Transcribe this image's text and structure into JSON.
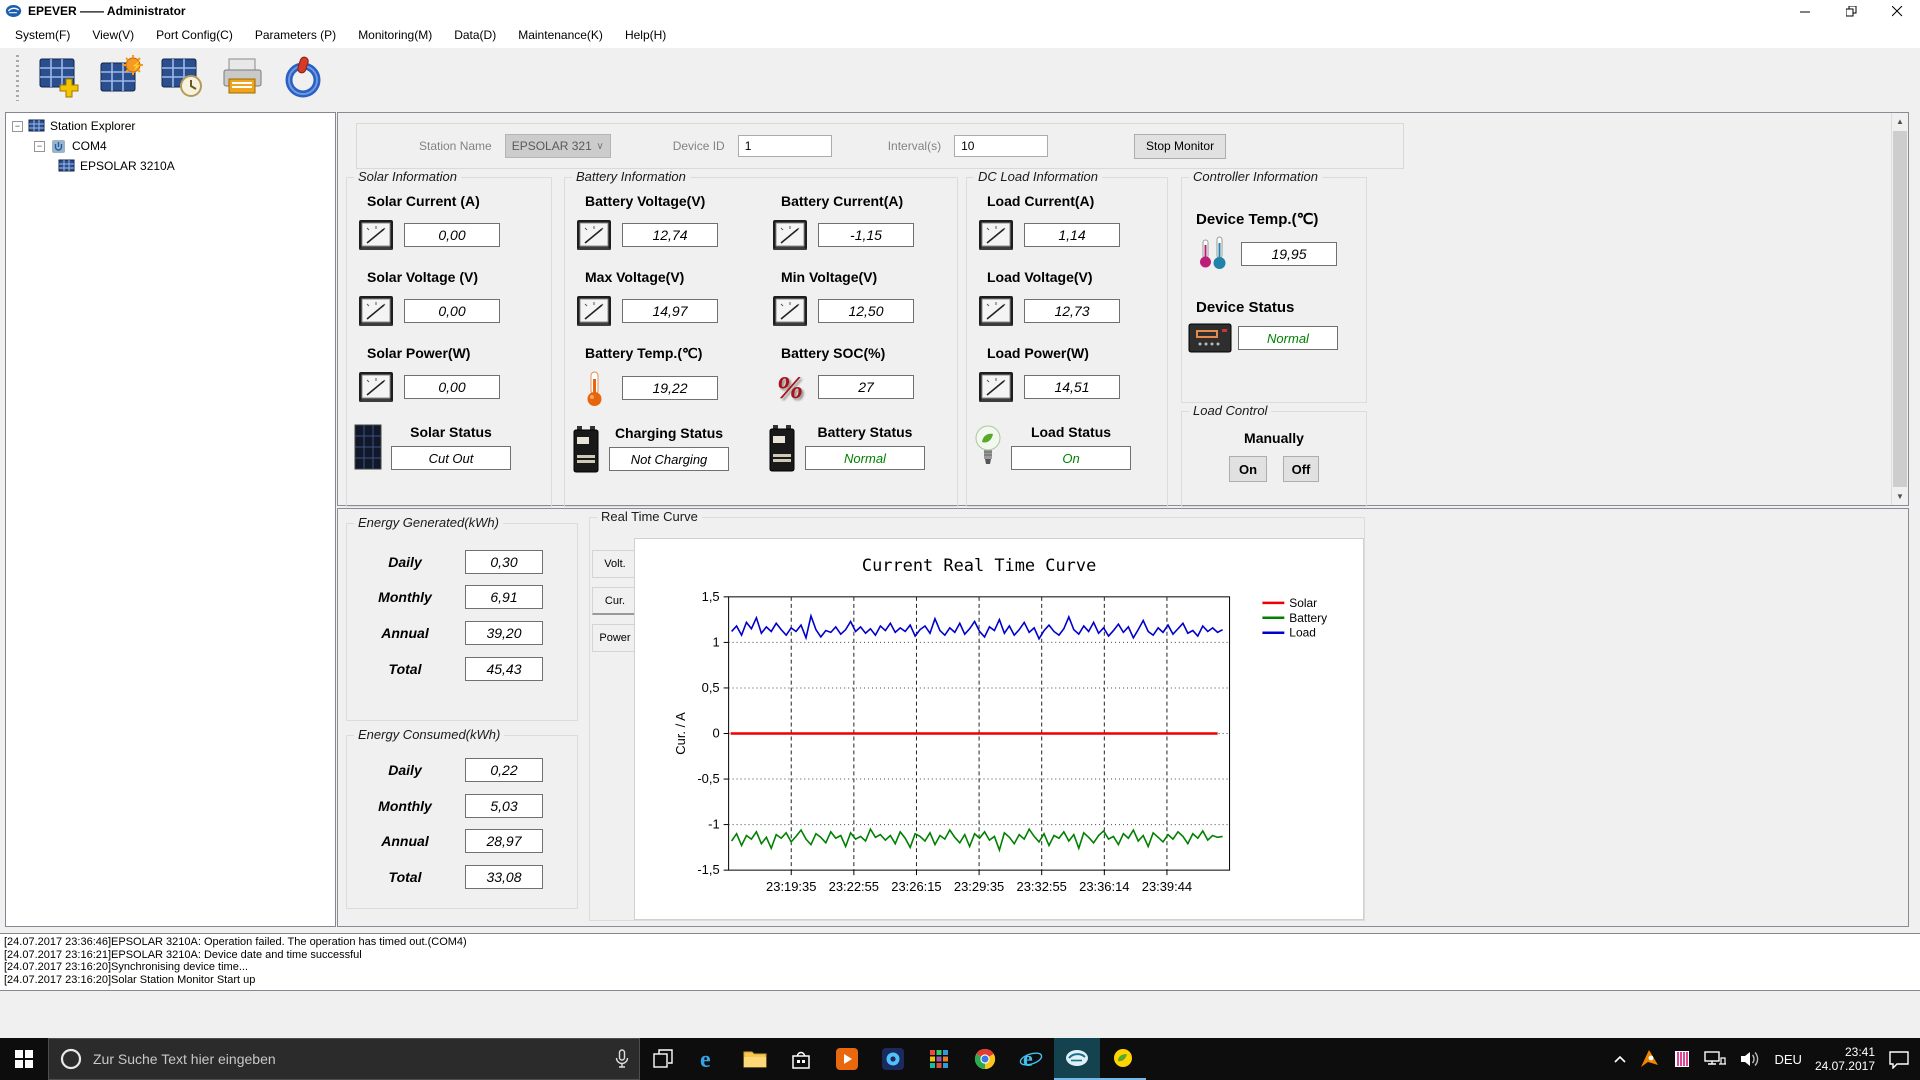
{
  "window": {
    "title": "EPEVER —— Administrator"
  },
  "menu": {
    "items": [
      "System(F)",
      "View(V)",
      "Port Config(C)",
      "Parameters (P)",
      "Monitoring(M)",
      "Data(D)",
      "Maintenance(K)",
      "Help(H)"
    ]
  },
  "icons": {
    "toolbar": [
      "add-station",
      "station-settings",
      "station-time",
      "print",
      "power-exit"
    ],
    "tray": [
      "chevron-up",
      "avast-antivirus",
      "input-method",
      "network",
      "volume",
      "action-center"
    ]
  },
  "tree": {
    "root": "Station Explorer",
    "port": "COM4",
    "device": "EPSOLAR 3210A"
  },
  "monitor_form": {
    "station_name_label": "Station Name",
    "station_name_value": "EPSOLAR 321",
    "device_id_label": "Device ID",
    "device_id_value": "1",
    "interval_label": "Interval(s)",
    "interval_value": "10",
    "stop_button": "Stop Monitor"
  },
  "solar": {
    "title": "Solar Information",
    "fields": [
      {
        "label": "Solar Current (A)",
        "value": "0,00"
      },
      {
        "label": "Solar Voltage (V)",
        "value": "0,00"
      },
      {
        "label": "Solar Power(W)",
        "value": "0,00"
      }
    ],
    "status": {
      "label": "Solar Status",
      "value": "Cut Out",
      "color": "#000000"
    }
  },
  "battery": {
    "title": "Battery Information",
    "fields": [
      {
        "label": "Battery Voltage(V)",
        "value": "12,74"
      },
      {
        "label": "Battery Current(A)",
        "value": "-1,15"
      },
      {
        "label": "Max Voltage(V)",
        "value": "14,97"
      },
      {
        "label": "Min Voltage(V)",
        "value": "12,50"
      },
      {
        "label": "Battery Temp.(℃)",
        "value": "19,22"
      },
      {
        "label": "Battery SOC(%)",
        "value": "27"
      }
    ],
    "charging_status": {
      "label": "Charging Status",
      "value": "Not Charging",
      "color": "#000000"
    },
    "battery_status": {
      "label": "Battery Status",
      "value": "Normal",
      "color": "#008000"
    }
  },
  "dc_load": {
    "title": "DC Load Information",
    "fields": [
      {
        "label": "Load Current(A)",
        "value": "1,14"
      },
      {
        "label": "Load Voltage(V)",
        "value": "12,73"
      },
      {
        "label": "Load Power(W)",
        "value": "14,51"
      }
    ],
    "status": {
      "label": "Load Status",
      "value": "On",
      "color": "#008000"
    }
  },
  "controller": {
    "title": "Controller Information",
    "temp_label": "Device Temp.(℃)",
    "temp_value": "19,95",
    "status": {
      "label": "Device Status",
      "value": "Normal",
      "color": "#008000"
    }
  },
  "load_control": {
    "title": "Load Control",
    "manually_label": "Manually",
    "on_button": "On",
    "off_button": "Off"
  },
  "energy_generated": {
    "title": "Energy Generated(kWh)",
    "rows": [
      {
        "label": "Daily",
        "value": "0,30"
      },
      {
        "label": "Monthly",
        "value": "6,91"
      },
      {
        "label": "Annual",
        "value": "39,20"
      },
      {
        "label": "Total",
        "value": "45,43"
      }
    ]
  },
  "energy_consumed": {
    "title": "Energy Consumed(kWh)",
    "rows": [
      {
        "label": "Daily",
        "value": "0,22"
      },
      {
        "label": "Monthly",
        "value": "5,03"
      },
      {
        "label": "Annual",
        "value": "28,97"
      },
      {
        "label": "Total",
        "value": "33,08"
      }
    ]
  },
  "rtc": {
    "title": "Real Time Curve",
    "tabs": [
      "Volt.",
      "Cur.",
      "Power"
    ]
  },
  "chart_data": {
    "type": "line",
    "title": "Current Real Time Curve",
    "ylabel": "Cur. / A",
    "ylim": [
      -1.5,
      1.5
    ],
    "yticks": [
      "1,5",
      "1",
      "0,5",
      "0",
      "-0,5",
      "-1",
      "-1,5"
    ],
    "xticklabels": [
      "23:19:35",
      "23:22:55",
      "23:26:15",
      "23:29:35",
      "23:32:55",
      "23:36:14",
      "23:39:44"
    ],
    "grid": true,
    "legend_position": "right",
    "legend": [
      {
        "name": "Solar",
        "color": "#ee0000"
      },
      {
        "name": "Battery",
        "color": "#008000"
      },
      {
        "name": "Load",
        "color": "#0000cc"
      }
    ],
    "series": [
      {
        "name": "Solar",
        "color": "#ee0000",
        "constant": 0
      },
      {
        "name": "Battery",
        "color": "#008000",
        "values": [
          -1.18,
          -1.1,
          -1.23,
          -1.12,
          -1.16,
          -1.08,
          -1.21,
          -1.14,
          -1.26,
          -1.11,
          -1.15,
          -1.09,
          -1.19,
          -1.13,
          -1.06,
          -1.16,
          -1.22,
          -1.1,
          -1.14,
          -1.2,
          -1.08,
          -1.15,
          -1.12,
          -1.24,
          -1.09,
          -1.16,
          -1.13,
          -1.18,
          -1.05,
          -1.14,
          -1.11,
          -1.17,
          -1.12,
          -1.21,
          -1.08,
          -1.15,
          -1.25,
          -1.1,
          -1.13,
          -1.18,
          -1.09,
          -1.22,
          -1.12,
          -1.16,
          -1.06,
          -1.14,
          -1.2,
          -1.11,
          -1.24,
          -1.1,
          -1.15,
          -1.08,
          -1.17,
          -1.13,
          -1.28,
          -1.09,
          -1.14,
          -1.21,
          -1.11,
          -1.16,
          -1.05,
          -1.13,
          -1.19,
          -1.1,
          -1.23,
          -1.12,
          -1.15,
          -1.08,
          -1.18,
          -1.11,
          -1.26,
          -1.09,
          -1.14,
          -1.2,
          -1.12,
          -1.07,
          -1.16,
          -1.13,
          -1.22,
          -1.1,
          -1.15,
          -1.06,
          -1.18,
          -1.12,
          -1.24,
          -1.09,
          -1.14,
          -1.19,
          -1.11,
          -1.16,
          -1.08,
          -1.13,
          -1.21,
          -1.1,
          -1.15,
          -1.07,
          -1.17,
          -1.12,
          -1.14,
          -1.13
        ]
      },
      {
        "name": "Load",
        "color": "#0000cc",
        "values": [
          1.12,
          1.18,
          1.08,
          1.22,
          1.15,
          1.27,
          1.1,
          1.17,
          1.12,
          1.21,
          1.14,
          1.08,
          1.16,
          1.12,
          1.19,
          1.05,
          1.29,
          1.14,
          1.06,
          1.13,
          1.11,
          1.17,
          1.09,
          1.14,
          1.23,
          1.12,
          1.17,
          1.1,
          1.15,
          1.08,
          1.18,
          1.13,
          1.21,
          1.11,
          1.16,
          1.12,
          1.19,
          1.07,
          1.14,
          1.18,
          1.1,
          1.26,
          1.13,
          1.08,
          1.16,
          1.11,
          1.21,
          1.09,
          1.15,
          1.23,
          1.12,
          1.06,
          1.17,
          1.13,
          1.25,
          1.1,
          1.18,
          1.08,
          1.14,
          1.22,
          1.11,
          1.16,
          1.04,
          1.13,
          1.19,
          1.12,
          1.08,
          1.15,
          1.28,
          1.14,
          1.09,
          1.18,
          1.12,
          1.22,
          1.1,
          1.16,
          1.07,
          1.13,
          1.2,
          1.11,
          1.17,
          1.05,
          1.14,
          1.24,
          1.12,
          1.08,
          1.16,
          1.11,
          1.19,
          1.09,
          1.15,
          1.21,
          1.1,
          1.13,
          1.07,
          1.18,
          1.12,
          1.16,
          1.11,
          1.14
        ]
      }
    ]
  },
  "log": {
    "lines": [
      "[24.07.2017 23:36:46]EPSOLAR 3210A: Operation failed. The operation has timed out.(COM4)",
      "[24.07.2017 23:16:21]EPSOLAR 3210A: Device date and time successful",
      "[24.07.2017 23:16:20]Synchronising device time...",
      "[24.07.2017 23:16:20]Solar Station Monitor Start up"
    ]
  },
  "taskbar": {
    "search_placeholder": "Zur Suche Text hier eingeben",
    "language": "DEU",
    "time": "23:41",
    "date": "24.07.2017"
  }
}
